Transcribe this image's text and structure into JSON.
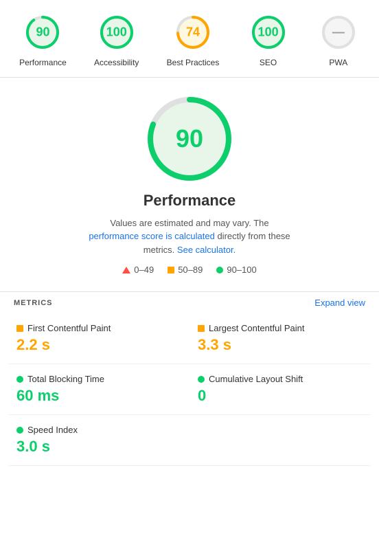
{
  "scores": [
    {
      "label": "Performance",
      "value": "90",
      "color": "#0cce6b",
      "textColor": "green",
      "bg": "#e8f5e9",
      "strokeColor": "#0cce6b",
      "strokeDash": "80",
      "type": "green"
    },
    {
      "label": "Accessibility",
      "value": "100",
      "color": "#0cce6b",
      "textColor": "green",
      "bg": "#e8f5e9",
      "strokeColor": "#0cce6b",
      "strokeDash": "100",
      "type": "green"
    },
    {
      "label": "Best Practices",
      "value": "74",
      "color": "#ffa400",
      "textColor": "orange",
      "bg": "#fff8e1",
      "strokeColor": "#ffa400",
      "strokeDash": "74",
      "type": "orange"
    },
    {
      "label": "SEO",
      "value": "100",
      "color": "#0cce6b",
      "textColor": "green",
      "bg": "#e8f5e9",
      "strokeColor": "#0cce6b",
      "strokeDash": "100",
      "type": "green"
    },
    {
      "label": "PWA",
      "value": "—",
      "color": "#9e9e9e",
      "textColor": "gray",
      "bg": "#f5f5f5",
      "strokeColor": "#e0e0e0",
      "strokeDash": "0",
      "type": "gray"
    }
  ],
  "performance": {
    "score": "90",
    "title": "Performance",
    "desc_text": "Values are estimated and may vary. The ",
    "link1_text": "performance score is calculated",
    "desc_text2": " directly from these metrics. ",
    "link2_text": "See calculator.",
    "expand_label": "Expand view"
  },
  "legend": [
    {
      "range": "0–49",
      "type": "triangle"
    },
    {
      "range": "50–89",
      "type": "square"
    },
    {
      "range": "90–100",
      "type": "circle"
    }
  ],
  "metrics_label": "METRICS",
  "metrics": [
    {
      "name": "First Contentful Paint",
      "value": "2.2 s",
      "type": "orange"
    },
    {
      "name": "Largest Contentful Paint",
      "value": "3.3 s",
      "type": "orange"
    },
    {
      "name": "Total Blocking Time",
      "value": "60 ms",
      "type": "green"
    },
    {
      "name": "Cumulative Layout Shift",
      "value": "0",
      "type": "green"
    },
    {
      "name": "Speed Index",
      "value": "3.0 s",
      "type": "green"
    },
    {
      "name": "",
      "value": "",
      "type": "none"
    }
  ]
}
